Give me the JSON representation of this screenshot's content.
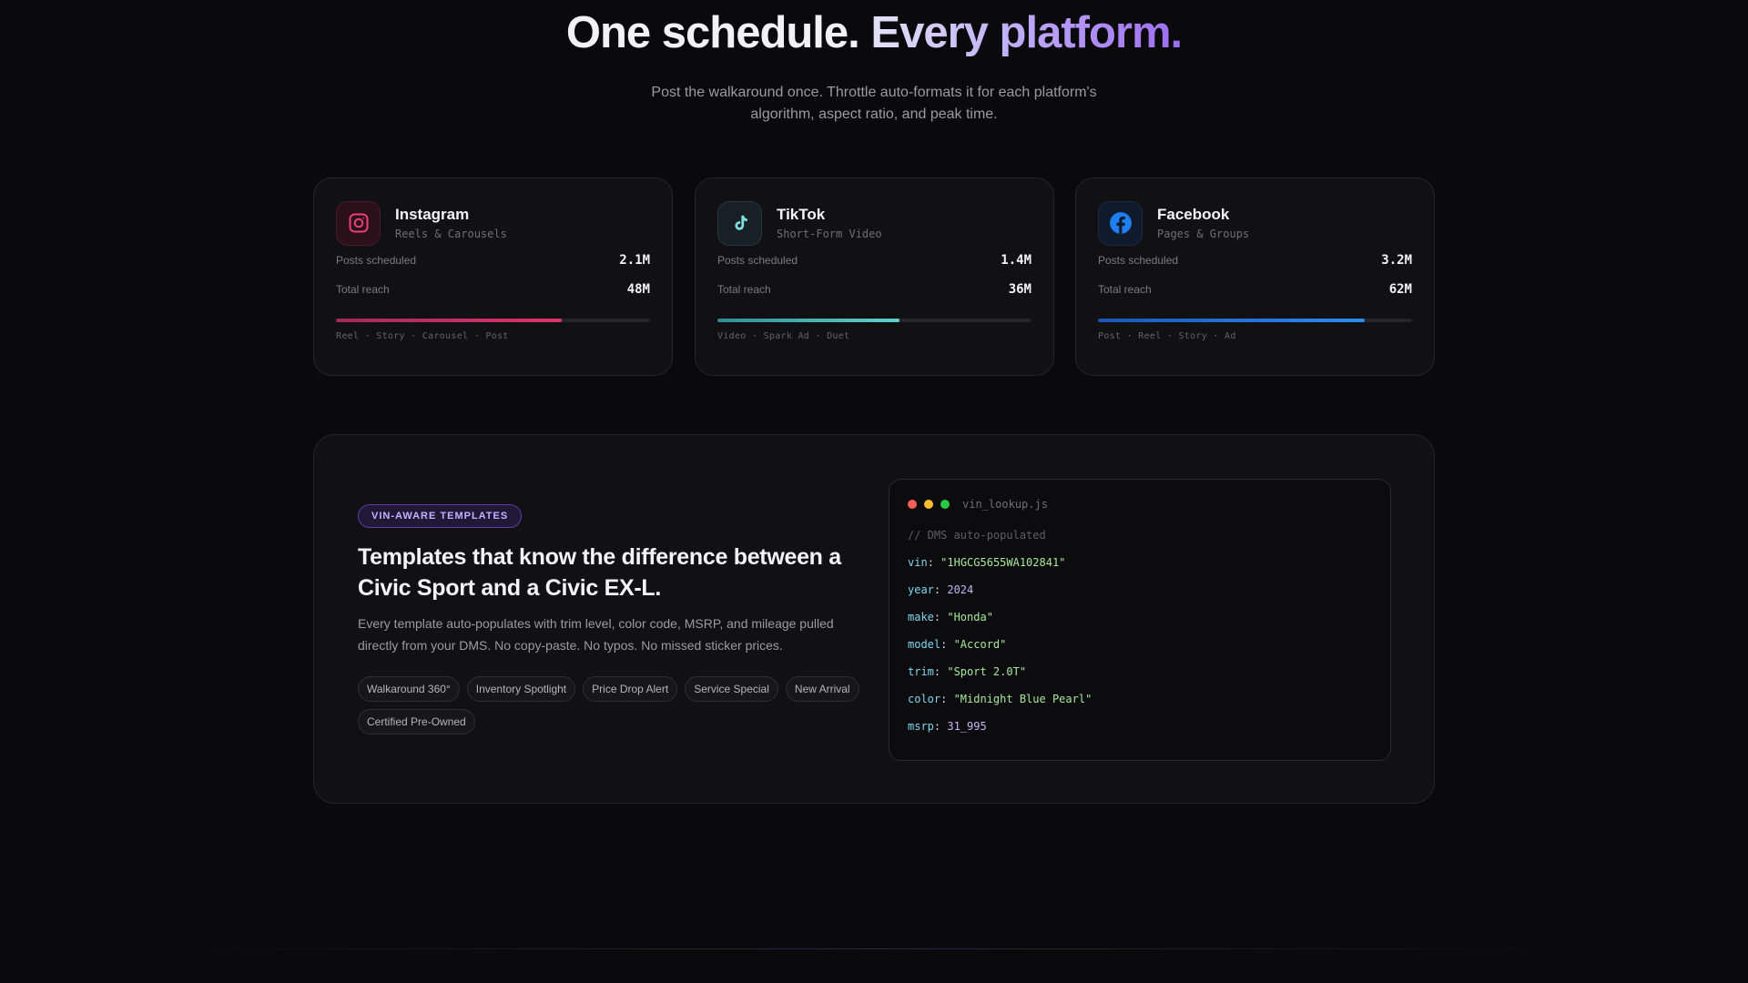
{
  "hero": {
    "title_main": "One schedule.",
    "title_accent": "Every platform.",
    "subtitle": "Post the walkaround once. Throttle auto-formats it for each platform's algorithm, aspect ratio, and peak time."
  },
  "platforms": [
    {
      "name": "Instagram",
      "subtitle": "Reels & Carousels",
      "icon": "instagram-icon",
      "color": "#e0336b",
      "posts_label": "Posts scheduled",
      "posts_value": "2.1M",
      "reach_label": "Total reach",
      "reach_value": "48M",
      "progress": 0.72,
      "formats": "Reel · Story · Carousel · Post"
    },
    {
      "name": "TikTok",
      "subtitle": "Short-Form Video",
      "icon": "tiktok-icon",
      "color": "#4fc3c4",
      "posts_label": "Posts scheduled",
      "posts_value": "1.4M",
      "reach_label": "Total reach",
      "reach_value": "36M",
      "progress": 0.58,
      "formats": "Video · Spark Ad · Duet"
    },
    {
      "name": "Facebook",
      "subtitle": "Pages & Groups",
      "icon": "facebook-icon",
      "color": "#1f7ef0",
      "posts_label": "Posts scheduled",
      "posts_value": "3.2M",
      "reach_label": "Total reach",
      "reach_value": "62M",
      "progress": 0.85,
      "formats": "Post · Reel · Story · Ad"
    }
  ],
  "feature": {
    "badge": "VIN-AWARE TEMPLATES",
    "title": "Templates that know the difference between a Civic Sport and a Civic EX-L.",
    "description": "Every template auto-populates with trim level, color code, MSRP, and mileage pulled directly from your DMS. No copy-paste. No typos. No missed sticker prices.",
    "chips": [
      "Walkaround 360°",
      "Inventory Spotlight",
      "Price Drop Alert",
      "Service Special",
      "New Arrival",
      "Certified Pre-Owned"
    ]
  },
  "code": {
    "filename": "vin_lookup.js",
    "comment": "// DMS auto-populated",
    "lines": [
      {
        "key": "vin",
        "value": "\"1HGCG5655WA102841\"",
        "type": "string"
      },
      {
        "key": "year",
        "value": "2024",
        "type": "number"
      },
      {
        "key": "make",
        "value": "\"Honda\"",
        "type": "string"
      },
      {
        "key": "model",
        "value": "\"Accord\"",
        "type": "string"
      },
      {
        "key": "trim",
        "value": "\"Sport 2.0T\"",
        "type": "string"
      },
      {
        "key": "color",
        "value": "\"Midnight Blue Pearl\"",
        "type": "string"
      },
      {
        "key": "msrp",
        "value": "31_995",
        "type": "number"
      }
    ],
    "dot_colors": [
      "#ff5f57",
      "#febc2e",
      "#28c840"
    ]
  }
}
